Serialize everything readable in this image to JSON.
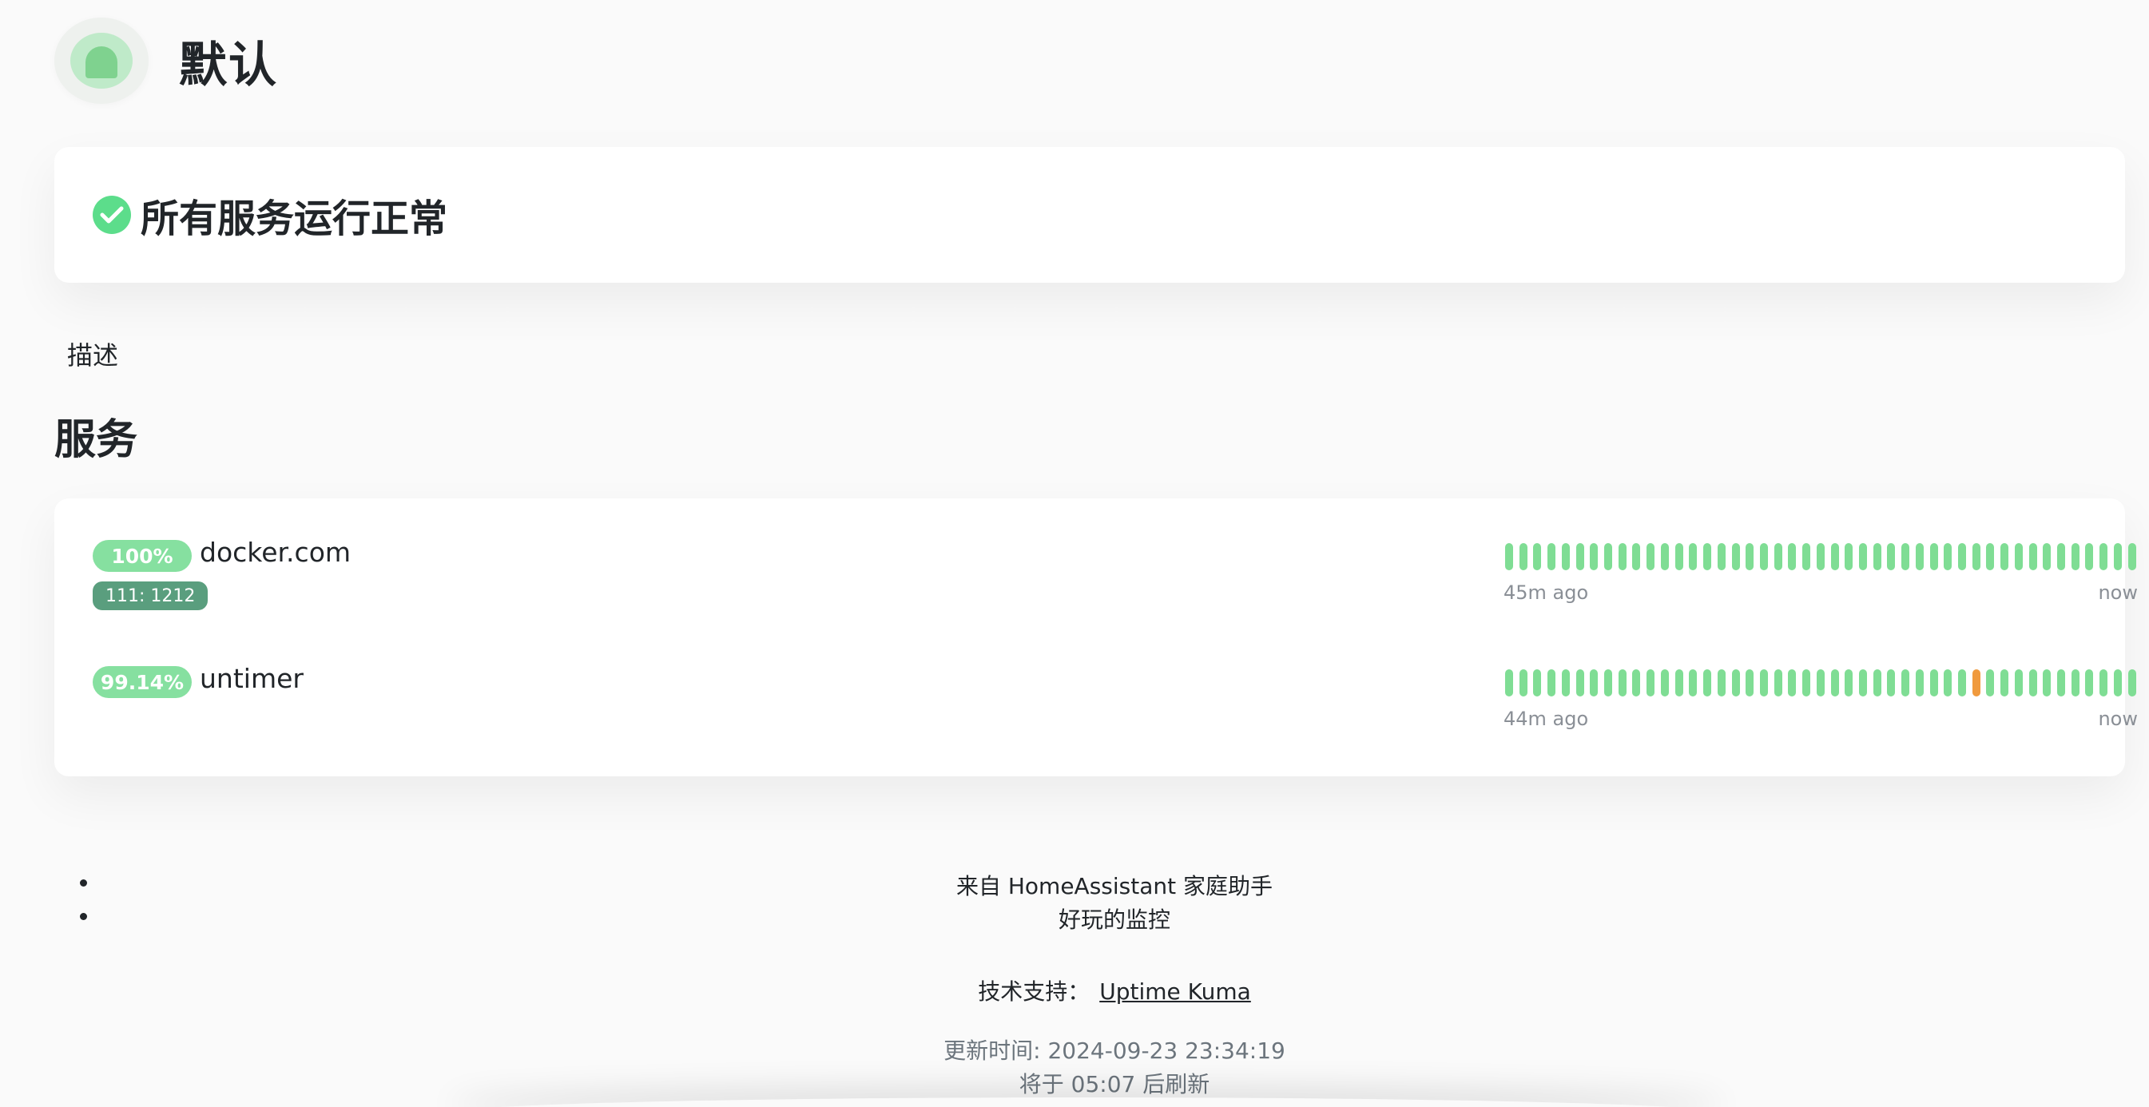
{
  "header": {
    "title": "默认",
    "logo_icon": "uptime-kuma-logo"
  },
  "status": {
    "text": "所有服务运行正常",
    "icon": "check-circle-icon",
    "color": "#5cdd8b"
  },
  "description": "描述",
  "services_heading": "服务",
  "monitors": [
    {
      "uptime": "100%",
      "name": "docker.com",
      "tag": "111: 1212",
      "time_left": "45m ago",
      "time_right": "now",
      "beats": [
        "up",
        "up",
        "up",
        "up",
        "up",
        "up",
        "up",
        "up",
        "up",
        "up",
        "up",
        "up",
        "up",
        "up",
        "up",
        "up",
        "up",
        "up",
        "up",
        "up",
        "up",
        "up",
        "up",
        "up",
        "up",
        "up",
        "up",
        "up",
        "up",
        "up",
        "up",
        "up",
        "up",
        "up",
        "up",
        "up",
        "up",
        "up",
        "up",
        "up",
        "up",
        "up",
        "up",
        "up",
        "up"
      ]
    },
    {
      "uptime": "99.14%",
      "name": "untimer",
      "tag": "",
      "time_left": "44m ago",
      "time_right": "now",
      "beats": [
        "up",
        "up",
        "up",
        "up",
        "up",
        "up",
        "up",
        "up",
        "up",
        "up",
        "up",
        "up",
        "up",
        "up",
        "up",
        "up",
        "up",
        "up",
        "up",
        "up",
        "up",
        "up",
        "up",
        "up",
        "up",
        "up",
        "up",
        "up",
        "up",
        "up",
        "up",
        "up",
        "up",
        "warn",
        "up",
        "up",
        "up",
        "up",
        "up",
        "up",
        "up",
        "up",
        "up",
        "up",
        "up"
      ]
    }
  ],
  "colors": {
    "up": "#7fdd94",
    "warn": "#f09a3e",
    "badge": "#86e0a0",
    "tag": "#5a9e7e"
  },
  "footer": {
    "line1": "来自 HomeAssistant 家庭助手",
    "line2": "好玩的监控",
    "powered_label": "技术支持：",
    "powered_link": "Uptime Kuma",
    "updated": "更新时间: 2024-09-23 23:34:19",
    "refresh": "将于 05:07 后刷新"
  }
}
